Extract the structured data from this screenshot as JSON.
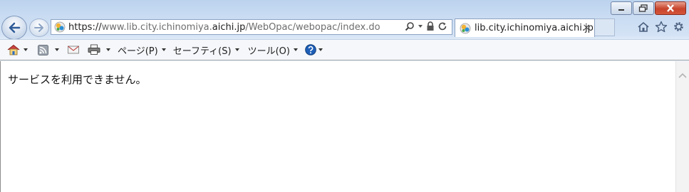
{
  "window": {
    "minimize_icon": "minimize-icon",
    "restore_icon": "restore-icon",
    "close_icon": "close-icon"
  },
  "address_bar": {
    "url_scheme": "https://",
    "url_pre": "www.lib.city.ichinomiya.",
    "url_host": "aichi.jp",
    "url_path": "/WebOpac/webopac/index.do"
  },
  "tab": {
    "title": "lib.city.ichinomiya.aichi.jp",
    "close_label": "×"
  },
  "command_bar": {
    "page_label": "ページ(P)",
    "safety_label": "セーフティ(S)",
    "tools_label": "ツール(O)"
  },
  "page": {
    "message": "サービスを利用できません。"
  },
  "colors": {
    "frame": "#c8dbf2",
    "close_button": "#c7442b",
    "help_icon": "#1e5fb8"
  }
}
